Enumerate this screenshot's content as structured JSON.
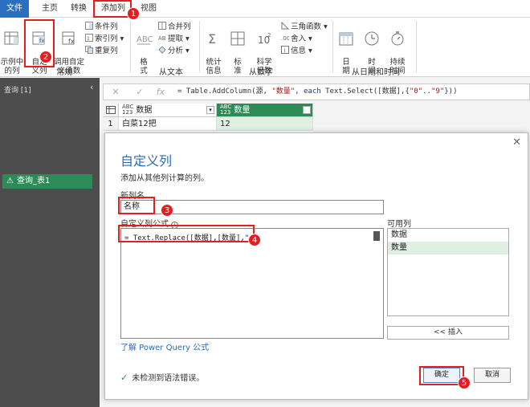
{
  "tabs": [
    "文件",
    "主页",
    "转换",
    "添加列",
    "视图"
  ],
  "ribbon": {
    "general": {
      "label": "常规",
      "example_col": "示例中\n的列",
      "custom_col": "自定\n义列",
      "invoke_fn": "调用自定\n义函数",
      "conditional_col": "条件列",
      "index_col": "索引列",
      "duplicate_col": "重复列"
    },
    "text": {
      "label": "从文本",
      "format": "格\n式",
      "merge_cols": "合并列",
      "extract": "提取",
      "parse": "分析"
    },
    "number": {
      "label": "从数字",
      "stats": "统计\n信息",
      "standard": "标\n准",
      "scientific": "科学\n记数",
      "trig": "三角函数",
      "rounding": "舍入",
      "info": "信息"
    },
    "datetime": {
      "label": "从日期和时间",
      "date": "日\n期",
      "time": "时\n间",
      "duration": "持续\n时间"
    }
  },
  "left_pane": {
    "title": "查询 [1]",
    "query_name": "查询_表1"
  },
  "formula_bar": {
    "prefix": "= Table.AddColumn(源, ",
    "s1": "\"数量\"",
    "mid1": ", ",
    "kw": "each",
    "mid2": " Text.Select([数据],{",
    "s2": "\"0\"",
    "mid3": "..",
    "s3": "\"9\"",
    "suffix": "}))"
  },
  "grid": {
    "columns": [
      "数据",
      "数量"
    ],
    "type_icon": "ABC\n123",
    "rows": [
      {
        "num": "1",
        "data": "白菜12把",
        "qty": "12"
      }
    ]
  },
  "dialog": {
    "title": "自定义列",
    "subtitle": "添加从其他列计算的列。",
    "new_col_label": "新列名",
    "new_col_value": "名称",
    "formula_label": "自定义列公式",
    "formula": "= Text.Replace([数据],[数量],\"\")",
    "available_label": "可用列",
    "available": [
      "数据",
      "数量"
    ],
    "insert": "<< 插入",
    "learn_link": "了解 Power Query 公式",
    "status": "未检测到语法错误。",
    "ok": "确定",
    "cancel": "取消"
  },
  "badges": [
    "1",
    "2",
    "3",
    "4",
    "5"
  ],
  "colors": {
    "accent": "#2a6cb8",
    "annotation": "#e02020",
    "file_tab": "#2b6fc2",
    "query_selected": "#2e8b57"
  }
}
